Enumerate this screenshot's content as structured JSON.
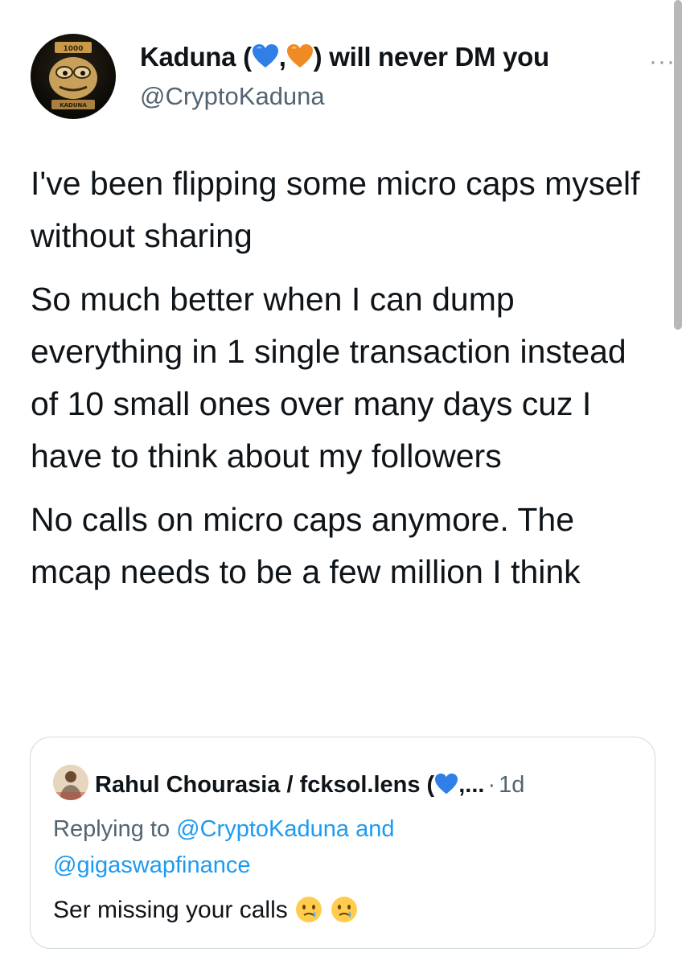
{
  "author": {
    "display_name_prefix": "Kaduna (",
    "display_name_comma": ",",
    "display_name_suffix": ") will never DM you",
    "handle": "@CryptoKaduna",
    "avatar_label": "KADUNA",
    "avatar_caption": "KADUNA"
  },
  "more_label": "···",
  "tweet": {
    "paragraphs": [
      "I've been flipping some micro caps myself without sharing",
      "So much better when I can dump everything in 1 single transaction instead of 10 small ones over many days cuz I have to think about my followers",
      "No calls on micro caps anymore. The mcap needs to be a few million I think"
    ]
  },
  "quoted": {
    "name_prefix": "Rahul Chourasia / fcksol.lens (",
    "name_suffix": ",...",
    "dot": "·",
    "time": "1d",
    "replying_prefix": "Replying to",
    "mention1": "@CryptoKaduna",
    "and": "and",
    "mention2": "@gigaswapfinance",
    "text": "Ser missing your calls"
  },
  "icons": {
    "heart_blue": "blue-heart-icon",
    "heart_orange": "orange-heart-icon",
    "crying_face": "crying-face-icon"
  },
  "colors": {
    "link": "#1d9bf0",
    "secondary_text": "#536471",
    "blue_heart": "#2f7fe6",
    "orange_heart": "#f08a24"
  }
}
